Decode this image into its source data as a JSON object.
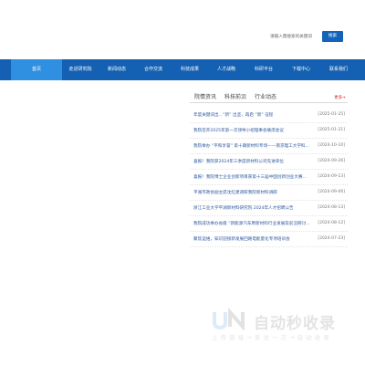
{
  "search": {
    "placeholder": "请输入需搜索的关键词",
    "button_label": "搜索"
  },
  "nav": {
    "items": [
      {
        "label": "首页",
        "active": true
      },
      {
        "label": "走进研究院",
        "active": false
      },
      {
        "label": "新闻动态",
        "active": false
      },
      {
        "label": "合作交流",
        "active": false
      },
      {
        "label": "科技成果",
        "active": false
      },
      {
        "label": "人才战略",
        "active": false
      },
      {
        "label": "科研平台",
        "active": false
      },
      {
        "label": "下载中心",
        "active": false
      },
      {
        "label": "联系我们",
        "active": false
      }
    ]
  },
  "news_panel": {
    "tabs": [
      "院情资讯",
      "科技前沿",
      "行业动态"
    ],
    "more_label": "更多+",
    "items": [
      {
        "title": "年度关键词出…“新” 出坚，再启 “新” 征程",
        "date": "[2025-01-25]"
      },
      {
        "title": "我院召开2025年第一次领导小组理事会联席会议",
        "date": "[2025-01-21]"
      },
      {
        "title": "我院举办 “平和享誉” 第十期新材料专场——南京理工大学科技成果在…",
        "date": "[2024-10-10]"
      },
      {
        "title": "喜报！我院获2024年三季度新材料公司先进单位",
        "date": "[2024-09-26]"
      },
      {
        "title": "喜报！我院博士企业创新项目获第十三届中国创新创业大赛（浙江…",
        "date": "[2024-09-13]"
      },
      {
        "title": "平湖市政协副主席沈红建调研我院新材料调研",
        "date": "[2024-09-06]"
      },
      {
        "title": "浙江工业大学平湖新材料研究院 2024年人才招聘公告",
        "date": "[2024-08-13]"
      },
      {
        "title": "我院成功举办省级 “新能源汽车用新材料行业发展及前沿研讨会” 活…",
        "date": "[2024-08-12]"
      },
      {
        "title": "聚焦运维，知识迎接新发展回路电能量化专项培训会",
        "date": "[2024-07-23]"
      }
    ]
  },
  "watermark": {
    "main": "自动秒收录",
    "sub": "上 传 链 接 → 来 访 一 次 → 自 动 收 录"
  },
  "colors": {
    "nav_bg": "#1460b2",
    "nav_active": "#2f8fe0",
    "button": "#1363b8",
    "link": "#2e5aa0",
    "more": "#d42a2a"
  }
}
